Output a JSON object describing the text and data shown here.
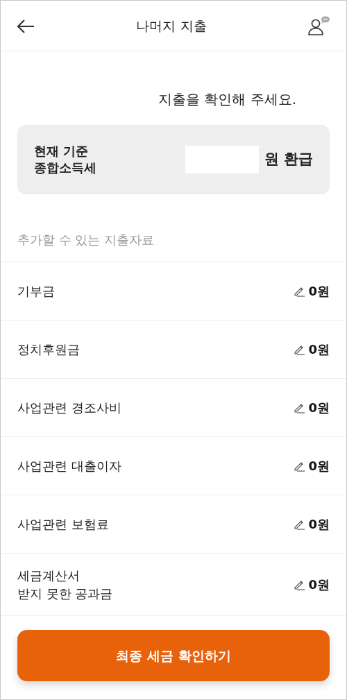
{
  "header": {
    "title": "나머지 지출"
  },
  "intro": "지출을 확인해 주세요.",
  "summary": {
    "label_lines": [
      "현재 기준",
      "종합소득세"
    ],
    "amount_hidden": true,
    "suffix": "원 환급"
  },
  "section_label": "추가할 수 있는 지출자료",
  "expenses": [
    {
      "name_lines": [
        "기부금"
      ],
      "amount": "0원"
    },
    {
      "name_lines": [
        "정치후원금"
      ],
      "amount": "0원"
    },
    {
      "name_lines": [
        "사업관련 경조사비"
      ],
      "amount": "0원"
    },
    {
      "name_lines": [
        "사업관련 대출이자"
      ],
      "amount": "0원"
    },
    {
      "name_lines": [
        "사업관련 보험료"
      ],
      "amount": "0원"
    },
    {
      "name_lines": [
        "세금계산서",
        "받지 못한 공과금"
      ],
      "amount": "0원"
    }
  ],
  "primary_button": "최종 세금 확인하기"
}
